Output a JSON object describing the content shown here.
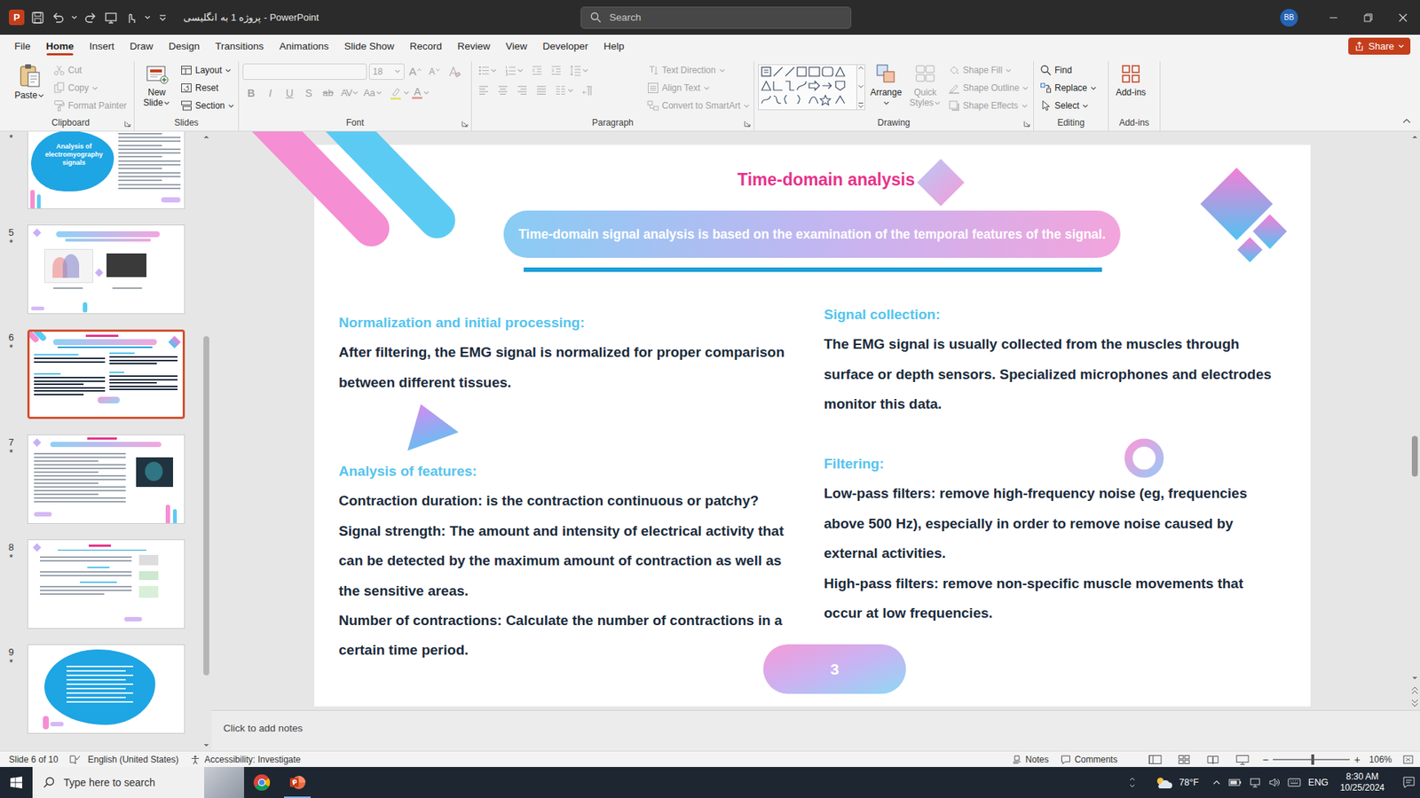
{
  "window": {
    "title": "پروژه 1 به انگلیسی - PowerPoint",
    "logo": "P"
  },
  "search": {
    "placeholder": "Search"
  },
  "account": {
    "initials": "BB"
  },
  "tabs": [
    {
      "label": "File",
      "selected": false
    },
    {
      "label": "Home",
      "selected": true
    },
    {
      "label": "Insert",
      "selected": false
    },
    {
      "label": "Draw",
      "selected": false
    },
    {
      "label": "Design",
      "selected": false
    },
    {
      "label": "Transitions",
      "selected": false
    },
    {
      "label": "Animations",
      "selected": false
    },
    {
      "label": "Slide Show",
      "selected": false
    },
    {
      "label": "Record",
      "selected": false
    },
    {
      "label": "Review",
      "selected": false
    },
    {
      "label": "View",
      "selected": false
    },
    {
      "label": "Developer",
      "selected": false
    },
    {
      "label": "Help",
      "selected": false
    }
  ],
  "share": {
    "label": "Share"
  },
  "ribbon": {
    "clipboard": {
      "label": "Clipboard",
      "paste": "Paste",
      "items": [
        {
          "label": "Cut",
          "disabled": true
        },
        {
          "label": "Copy",
          "disabled": true
        },
        {
          "label": "Format Painter",
          "disabled": true
        }
      ]
    },
    "slides": {
      "label": "Slides",
      "new_slide": "New Slide",
      "items": [
        {
          "label": "Layout",
          "disabled": false
        },
        {
          "label": "Reset",
          "disabled": false
        },
        {
          "label": "Section",
          "disabled": false
        }
      ]
    },
    "font": {
      "label": "Font",
      "size": "18",
      "grow": "A",
      "shrink": "A",
      "buttons": [
        "B",
        "I",
        "U",
        "S",
        "ab",
        "AV",
        "Aa"
      ],
      "color_letter": "A",
      "disabled": true
    },
    "paragraph": {
      "label": "Paragraph",
      "disabled": true,
      "items": [
        {
          "label": "Text Direction",
          "disabled": true
        },
        {
          "label": "Align Text",
          "disabled": true
        },
        {
          "label": "Convert to SmartArt",
          "disabled": true
        }
      ]
    },
    "drawing": {
      "label": "Drawing",
      "arrange": {
        "label": "Arrange",
        "disabled": false
      },
      "quick_styles": {
        "label": "Quick Styles",
        "disabled": true
      },
      "items": [
        {
          "label": "Shape Fill",
          "disabled": true
        },
        {
          "label": "Shape Outline",
          "disabled": true
        },
        {
          "label": "Shape Effects",
          "disabled": true
        }
      ]
    },
    "editing": {
      "label": "Editing",
      "items": [
        {
          "label": "Find",
          "disabled": false
        },
        {
          "label": "Replace",
          "disabled": false
        },
        {
          "label": "Select",
          "disabled": false
        }
      ]
    },
    "addins": {
      "label": "Add-ins",
      "button": "Add-ins"
    }
  },
  "thumbnails": [
    {
      "star": "*",
      "kind": "title-blob",
      "title": "Analysis of electromyography signals",
      "selected": false
    },
    {
      "number": "5",
      "star": "*",
      "kind": "two-charts",
      "selected": false
    },
    {
      "number": "6",
      "star": "*",
      "kind": "current",
      "selected": true
    },
    {
      "number": "7",
      "star": "*",
      "kind": "text-image",
      "selected": false
    },
    {
      "number": "8",
      "star": "*",
      "kind": "icons-list",
      "selected": false
    },
    {
      "number": "9",
      "star": "*",
      "kind": "blob-text",
      "selected": false
    }
  ],
  "slide": {
    "title": "Time-domain analysis",
    "subtitle": "Time-domain signal analysis is based on the examination of the temporal features of the signal.",
    "sections": [
      {
        "heading": "Normalization and initial processing:",
        "lines": [
          "After filtering, the EMG signal is normalized for proper comparison",
          "between different tissues."
        ]
      },
      {
        "heading": "Analysis of features:",
        "lines": [
          "Contraction duration: is the contraction continuous or patchy?",
          "Signal strength: The amount and intensity of electrical activity that",
          "can be detected by the maximum amount of contraction as well as",
          "the sensitive areas.",
          "Number of contractions: Calculate the number of contractions in a",
          "certain time period."
        ]
      },
      {
        "heading": "Signal collection:",
        "lines": [
          "The EMG signal is usually collected from the muscles through",
          "surface or depth sensors. Specialized microphones and electrodes",
          "monitor this data."
        ]
      },
      {
        "heading": "Filtering:",
        "lines": [
          "Low-pass filters: remove high-frequency noise (eg, frequencies",
          "above 500 Hz), especially in order to remove noise caused by",
          "external activities.",
          "High-pass filters: remove non-specific muscle movements that",
          "occur at low frequencies."
        ]
      }
    ],
    "page": "3"
  },
  "notes": {
    "placeholder": "Click to add notes"
  },
  "scrollbars": {
    "thumbnails": {
      "level": 0.75
    },
    "slide": {
      "level": 0.6
    }
  },
  "status_bar": {
    "slide": "Slide 6 of 10",
    "language": "English (United States)",
    "accessibility": "Accessibility: Investigate",
    "notes": "Notes",
    "comments": "Comments",
    "zoom_minus": "−",
    "zoom_plus": "+",
    "zoom": "106%",
    "zoom_level": 0.52
  },
  "taskbar": {
    "search_placeholder": "Type here to search",
    "weather": "78°F",
    "language": "ENG",
    "time": "8:30 AM",
    "date": "10/25/2024"
  }
}
